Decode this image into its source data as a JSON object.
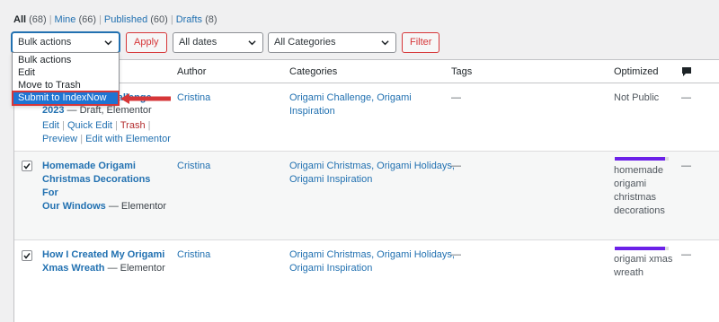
{
  "status_filters": {
    "all": {
      "label": "All",
      "count": "(68)"
    },
    "mine": {
      "label": "Mine",
      "count": "(66)"
    },
    "published": {
      "label": "Published",
      "count": "(60)"
    },
    "drafts": {
      "label": "Drafts",
      "count": "(8)"
    },
    "separator": "|"
  },
  "actions": {
    "bulk_select": "Bulk actions",
    "apply": "Apply",
    "dates_select": "All dates",
    "categories_select": "All Categories",
    "filter": "Filter"
  },
  "bulk_dropdown": {
    "items": [
      "Bulk actions",
      "Edit",
      "Move to Trash",
      "Submit to IndexNow"
    ],
    "highlighted": "Submit to IndexNow"
  },
  "columns": {
    "author": "Author",
    "categories": "Categories",
    "tags": "Tags",
    "optimized": "Optimized"
  },
  "rows": [
    {
      "title_partial_1": "hallenge",
      "title_partial_2": "2023",
      "state": "— Draft, Elementor",
      "actions": {
        "edit": "Edit",
        "quick_edit": "Quick Edit",
        "trash": "Trash",
        "preview": "Preview",
        "edit_elementor": "Edit with Elementor",
        "sep": "|"
      },
      "author": "Cristina",
      "categories": [
        "Origami Challenge, Origami",
        "Inspiration"
      ],
      "tags": "—",
      "optimized": "Not Public",
      "comments": "—"
    },
    {
      "title_lines": [
        "Homemade Origami",
        "Christmas Decorations For",
        "Our Windows"
      ],
      "state": "— Elementor",
      "author": "Cristina",
      "categories": [
        "Origami Christmas, Origami Holidays,",
        "Origami Inspiration"
      ],
      "tags": "—",
      "optimized": [
        "homemade",
        "origami",
        "christmas",
        "decorations"
      ],
      "comments": "—"
    },
    {
      "title_lines": [
        "How I Created My Origami",
        "Xmas Wreath"
      ],
      "state": "— Elementor",
      "author": "Cristina",
      "categories": [
        "Origami Christmas, Origami Holidays,",
        "Origami Inspiration"
      ],
      "tags": "—",
      "optimized": [
        "origami xmas",
        "wreath"
      ],
      "comments": "—"
    }
  ],
  "colors": {
    "link": "#2271b1",
    "danger": "#d63638",
    "highlight": "#1e74d3",
    "optimized_bar": "#6b21e8"
  }
}
